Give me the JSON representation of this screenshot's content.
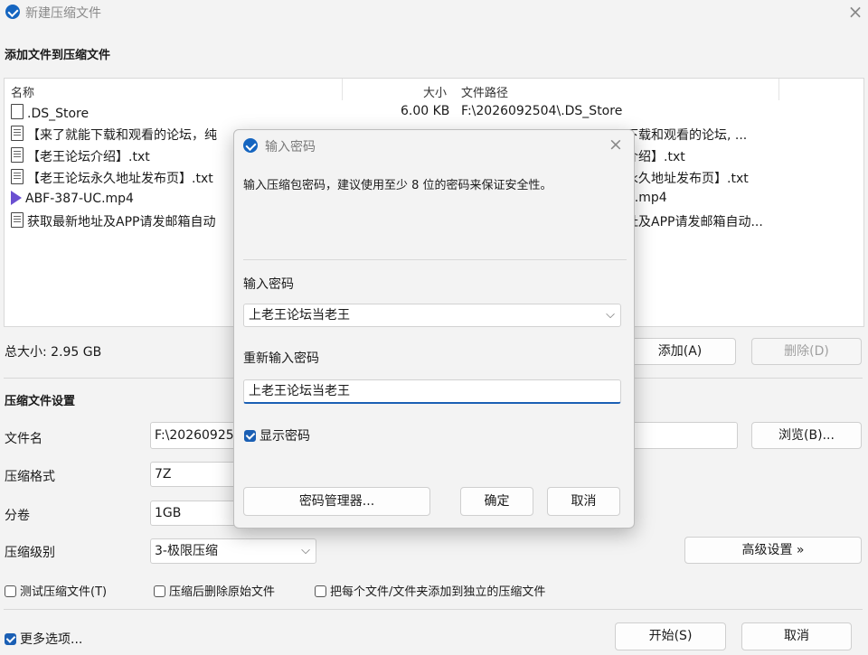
{
  "window": {
    "title": "新建压缩文件",
    "close": "×"
  },
  "files_section": {
    "title": "添加文件到压缩文件"
  },
  "table": {
    "headers": {
      "name": "名称",
      "size": "大小",
      "path": "文件路径"
    },
    "rows": [
      {
        "icon": "file-icon",
        "name": ".DS_Store",
        "size": "6.00 KB",
        "path": "F:\\2026092504\\.DS_Store"
      },
      {
        "icon": "text-file-icon",
        "name": "【来了就能下载和观看的论坛，纯",
        "size": "",
        "path": "下载和观看的论坛, ..."
      },
      {
        "icon": "text-file-icon",
        "name": "【老王论坛介绍】.txt",
        "size": "",
        "path": "介绍】.txt"
      },
      {
        "icon": "text-file-icon",
        "name": "【老王论坛永久地址发布页】.txt",
        "size": "",
        "path": "永久地址发布页】.txt"
      },
      {
        "icon": "video-file-icon",
        "name": "ABF-387-UC.mp4",
        "size": "",
        "path": "C.mp4"
      },
      {
        "icon": "text-file-icon",
        "name": "获取最新地址及APP请发邮箱自动",
        "size": "",
        "path": "址及APP请发邮箱自动..."
      }
    ]
  },
  "total": {
    "label": "总大小: 2.95 GB"
  },
  "buttons": {
    "add": "添加(A)",
    "delete": "删除(D)",
    "browse": "浏览(B)...",
    "advanced": "高级设置 »",
    "start": "开始(S)",
    "cancel": "取消"
  },
  "settings": {
    "title": "压缩文件设置",
    "filename_label": "文件名",
    "filename_value": "F:\\20260925",
    "format_label": "压缩格式",
    "format_value": "7Z",
    "volume_label": "分卷",
    "volume_value": "1GB",
    "level_label": "压缩级别",
    "level_value": "3-极限压缩"
  },
  "options": {
    "test": "测试压缩文件(T)",
    "delete_after": "压缩后删除原始文件",
    "separate": "把每个文件/文件夹添加到独立的压缩文件",
    "more": "更多选项..."
  },
  "dialog": {
    "title": "输入密码",
    "close": "×",
    "hint": "输入压缩包密码，建议使用至少 8 位的密码来保证安全性。",
    "password_label": "输入密码",
    "password_value": "上老王论坛当老王",
    "confirm_label": "重新输入密码",
    "confirm_value": "上老王论坛当老王",
    "show_password": "显示密码",
    "manager_button": "密码管理器...",
    "ok_button": "确定",
    "cancel_button": "取消"
  }
}
